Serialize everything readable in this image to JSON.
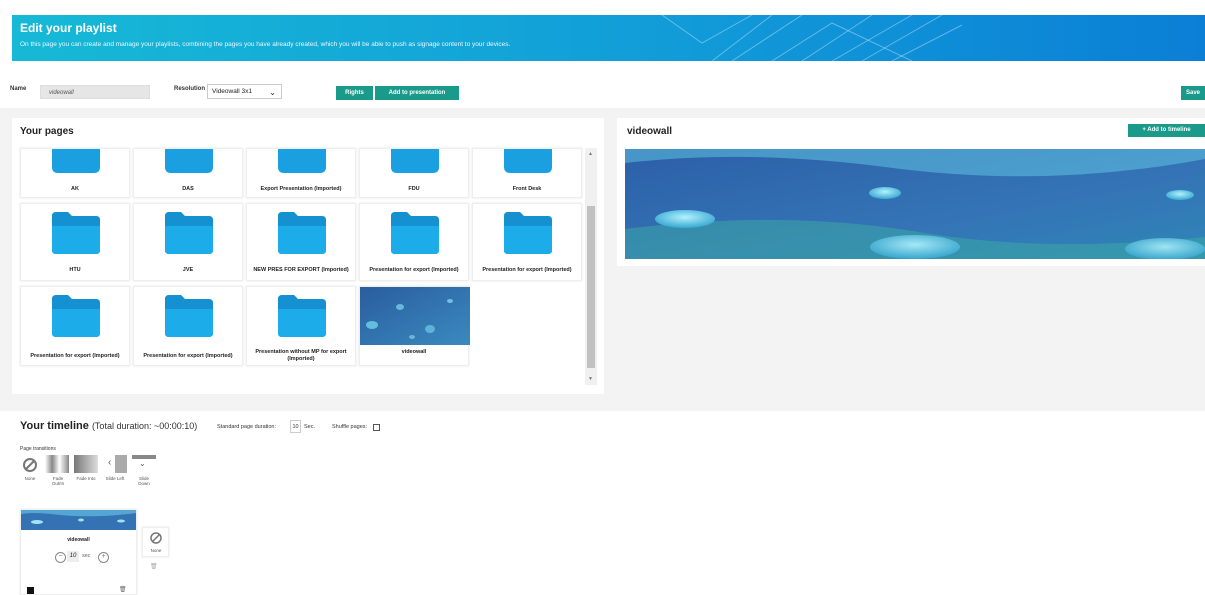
{
  "header": {
    "title": "Edit your playlist",
    "subtitle": "On this page you can create and manage your playlists, combining the pages you have already created, which you will be able to push as signage content to your devices."
  },
  "form": {
    "name_label": "Name",
    "name_value": "videowall",
    "resolution_label": "Resolution",
    "resolution_value": "Videowall 3x1",
    "rights_label": "Rights",
    "add_presentation_label": "Add to presentation",
    "save_label": "Save"
  },
  "pages": {
    "title": "Your pages",
    "items": [
      {
        "label": "AK",
        "kind": "folder"
      },
      {
        "label": "DAS",
        "kind": "folder"
      },
      {
        "label": "Export Presentation (Imported)",
        "kind": "folder"
      },
      {
        "label": "FDU",
        "kind": "folder"
      },
      {
        "label": "Front Desk",
        "kind": "folder"
      },
      {
        "label": "HTU",
        "kind": "folder"
      },
      {
        "label": "JVE",
        "kind": "folder"
      },
      {
        "label": "NEW PRES FOR EXPORT (Imported)",
        "kind": "folder"
      },
      {
        "label": "Presentation for export (Imported)",
        "kind": "folder"
      },
      {
        "label": "Presentation for export (Imported)",
        "kind": "folder"
      },
      {
        "label": "Presentation for export (Imported)",
        "kind": "folder"
      },
      {
        "label": "Presentation for export (Imported)",
        "kind": "folder"
      },
      {
        "label": "Presentation without MP for export (Imported)",
        "kind": "folder"
      },
      {
        "label": "videowall",
        "kind": "image"
      }
    ]
  },
  "preview": {
    "title": "videowall",
    "add_timeline_label": "+ Add to timeline"
  },
  "timeline": {
    "title": "Your timeline",
    "duration": "(Total duration: ~00:00:10)",
    "std_duration_label": "Standard page duration:",
    "std_duration_value": "10",
    "std_duration_unit": "Sec.",
    "shuffle_label": "Shuffle pages:",
    "transitions_label": "Page transitions",
    "transitions": [
      "None",
      "Fade Out/In",
      "Fade Into",
      "Slide Left",
      "Slide Down"
    ],
    "item": {
      "label": "videowall",
      "seconds": "10",
      "unit": "sec",
      "transition": "None"
    }
  },
  "colors": {
    "accent": "#1a9a8a",
    "banner_start": "#17b9d6",
    "banner_end": "#0b7fd6",
    "folder": "#1aa0e0"
  }
}
